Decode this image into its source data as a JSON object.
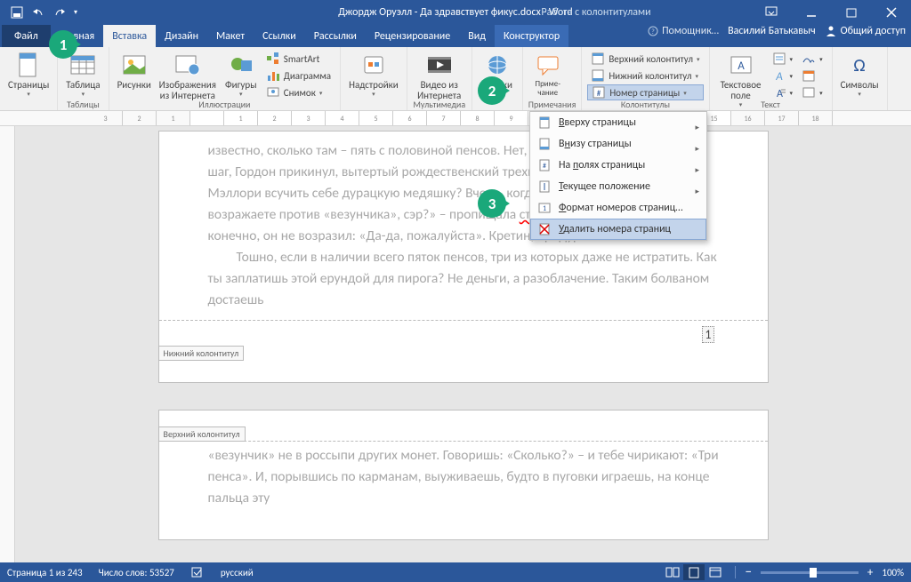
{
  "titlebar": {
    "doc_title": "Джордж Оруэлл - Да здравствует фикус.docx - Word",
    "header_tools_label": "Работа с колонтитулами"
  },
  "tabs": {
    "file": "Файл",
    "home": "Главная",
    "insert": "Вставка",
    "design": "Дизайн",
    "layout": "Макет",
    "references": "Ссылки",
    "mailings": "Рассылки",
    "review": "Рецензирование",
    "view": "Вид",
    "constructor": "Конструктор",
    "tell_me": "Помощник…",
    "user": "Василий Батькавыч",
    "share": "Общий доступ"
  },
  "ribbon": {
    "pages": {
      "label": "Страницы",
      "btn": "Страницы"
    },
    "tables": {
      "label": "Таблицы",
      "btn": "Таблица"
    },
    "illustrations": {
      "label": "Иллюстрации",
      "pictures": "Рисунки",
      "online": "Изображения из Интернета",
      "shapes": "Фигуры",
      "smartart": "SmartArt",
      "chart": "Диаграмма",
      "screenshot": "Снимок"
    },
    "addins": {
      "label": "Надстройки",
      "btn": "Надстройки"
    },
    "media": {
      "label": "Мультимедиа",
      "btn": "Видео из Интернета"
    },
    "links": {
      "label": "Ссылки",
      "btn": "Ссылки"
    },
    "comments": {
      "label": "Примечания",
      "btn": "Примечание"
    },
    "headerfooter": {
      "label": "Колонтитулы",
      "header": "Верхний колонтитул",
      "footer": "Нижний колонтитул",
      "pagenum": "Номер страницы"
    },
    "text": {
      "label": "Текст",
      "textbox": "Текстовое поле"
    },
    "symbols": {
      "label": "Символы",
      "btn": "Символы"
    }
  },
  "dropdown": {
    "top": "Вверху страницы",
    "bottom": "Внизу страницы",
    "margins": "На полях страницы",
    "current": "Текущее положение",
    "format": "Формат номеров страниц…",
    "remove": "Удалить номера страниц"
  },
  "document": {
    "footer_label": "Нижний колонтитул",
    "header_label": "Верхний колонтитул",
    "page_number": "1",
    "p1": "известно, сколько там – пять с половиной пенсов. Нет, даже и «везунчик». Замедлив шаг, Гордон прикинул, вытертый рождественский трехпенсовик. Это когда болван Мэллори всучить себе дурацкую медяшку? Вчера, когда покупал сигареты. «Не возражаете против «везунчика», сэр?» –  пропищала ",
    "p1_err": "стервоза",
    "p1_end": " продавщица. И уж конечно, он не возразил: «Да-да, пожалуйста». Кретин, придурок!",
    "p2": "Тошно, если в наличии всего пяток пенсов, три из которых даже не истратить. Как ты заплатишь этой ерундой для пирога? Не деньги, а разоблачение. Таким болваном достаешь",
    "p3": "«везунчик» не в россыпи других монет. Говоришь: «Сколько?» – и тебе чирикают: «Три пенса». И, порывшись по карманам, выуживаешь, будто в пуговки играешь, на конце пальца эту"
  },
  "status": {
    "page": "Страница 1 из 243",
    "words": "Число слов: 53527",
    "lang": "русский",
    "zoom": "100%"
  },
  "callouts": {
    "c1": "1",
    "c2": "2",
    "c3": "3"
  }
}
